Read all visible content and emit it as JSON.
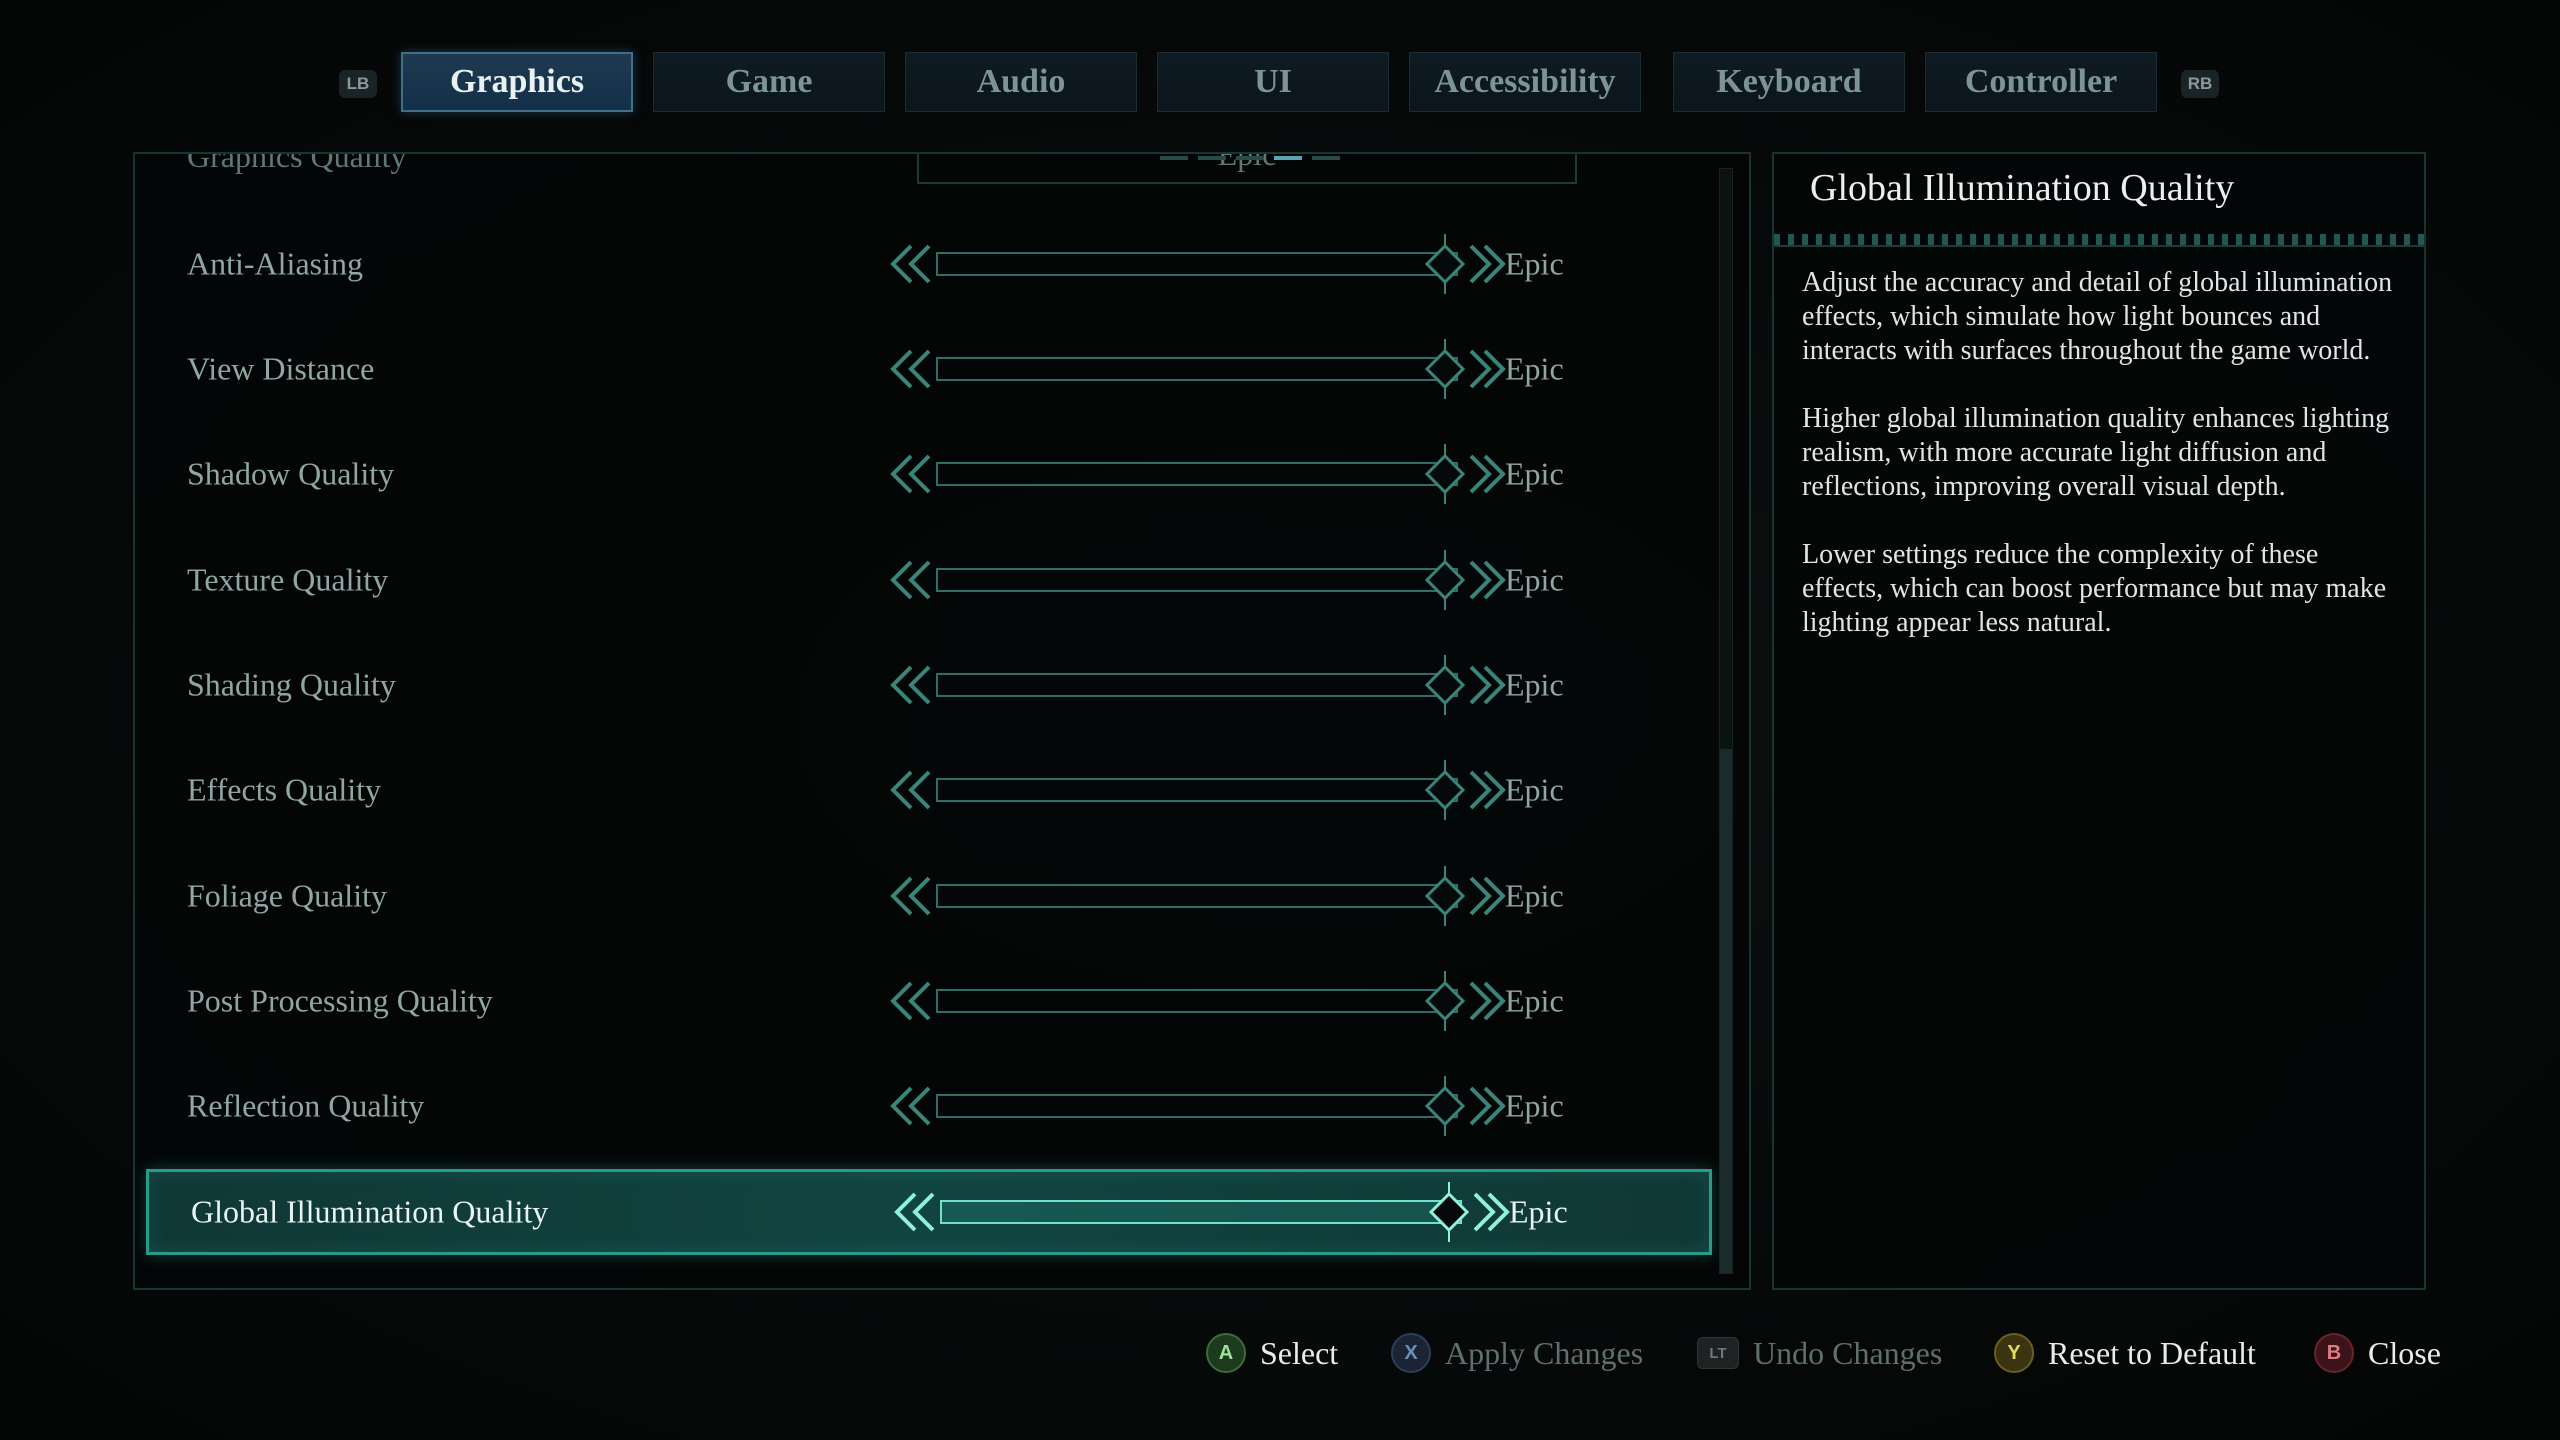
{
  "tabs": {
    "left_bumper": "LB",
    "right_bumper": "RB",
    "items": [
      {
        "label": "Graphics",
        "active": true
      },
      {
        "label": "Game",
        "active": false
      },
      {
        "label": "Audio",
        "active": false
      },
      {
        "label": "UI",
        "active": false
      },
      {
        "label": "Accessibility",
        "active": false
      },
      {
        "label": "Keyboard",
        "active": false
      },
      {
        "label": "Controller",
        "active": false
      }
    ]
  },
  "settings": {
    "partial": {
      "label": "Graphics Quality",
      "value": "Epic"
    },
    "rows": [
      {
        "label": "Anti-Aliasing",
        "value": "Epic"
      },
      {
        "label": "View Distance",
        "value": "Epic"
      },
      {
        "label": "Shadow Quality",
        "value": "Epic"
      },
      {
        "label": "Texture Quality",
        "value": "Epic"
      },
      {
        "label": "Shading Quality",
        "value": "Epic"
      },
      {
        "label": "Effects Quality",
        "value": "Epic"
      },
      {
        "label": "Foliage Quality",
        "value": "Epic"
      },
      {
        "label": "Post Processing Quality",
        "value": "Epic"
      },
      {
        "label": "Reflection Quality",
        "value": "Epic"
      },
      {
        "label": "Global Illumination Quality",
        "value": "Epic",
        "selected": true
      }
    ]
  },
  "description": {
    "title": "Global Illumination Quality",
    "paragraphs": [
      "Adjust the accuracy and detail of global illumination effects, which simulate how light bounces and interacts with surfaces throughout the game world.",
      "Higher global illumination quality enhances lighting realism, with more accurate light diffusion and reflections, improving overall visual depth.",
      "Lower settings reduce the complexity of these effects, which can boost performance but may make lighting appear less natural."
    ]
  },
  "footer": {
    "select": {
      "button": "A",
      "label": "Select"
    },
    "apply": {
      "button": "X",
      "label": "Apply Changes"
    },
    "undo": {
      "button": "LT",
      "label": "Undo Changes"
    },
    "reset": {
      "button": "Y",
      "label": "Reset to Default"
    },
    "close": {
      "button": "B",
      "label": "Close"
    }
  },
  "colors": {
    "accent": "#2a9a8a",
    "slider_stroke": "#2f6e66",
    "active_tab": "#1d3a4f"
  },
  "slider_icons": [
    "chevron-double-left-icon",
    "chevron-double-right-icon",
    "diamond-handle-icon"
  ]
}
